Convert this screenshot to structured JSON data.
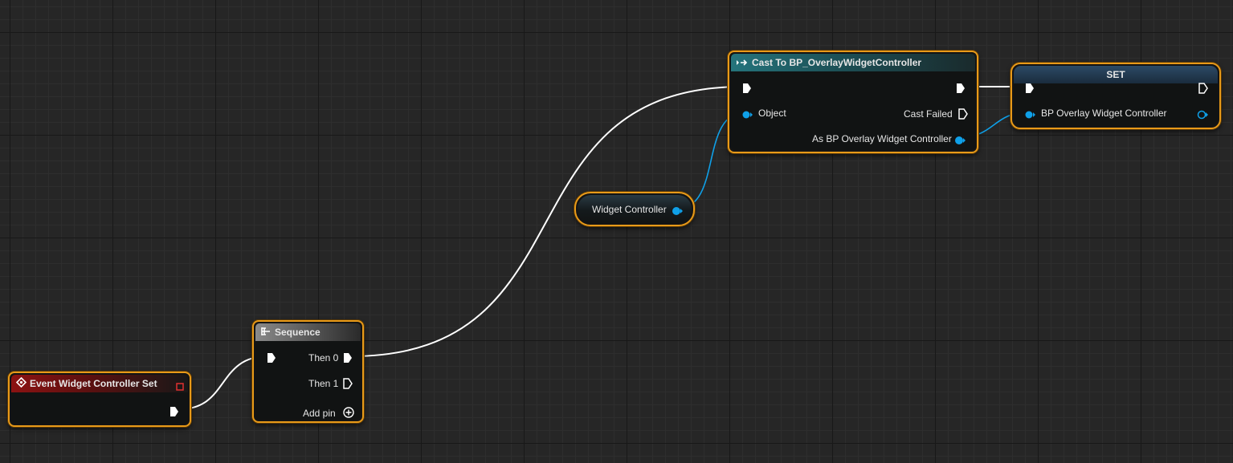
{
  "nodes": {
    "event": {
      "title": "Event Widget Controller Set"
    },
    "sequence": {
      "title": "Sequence",
      "then0": "Then 0",
      "then1": "Then 1",
      "add_pin": "Add pin"
    },
    "cast": {
      "title": "Cast To BP_OverlayWidgetController",
      "object": "Object",
      "cast_failed": "Cast Failed",
      "as_output": "As BP Overlay Widget Controller"
    },
    "getter": {
      "label": "Widget Controller"
    },
    "set": {
      "title": "SET",
      "var": "BP Overlay Widget Controller"
    }
  },
  "colors": {
    "exec": "#ffffff",
    "object_pin": "#0fa0e8",
    "selection": "#e89a19",
    "event_header": "#8c1212",
    "cast_header": "#25747c"
  }
}
